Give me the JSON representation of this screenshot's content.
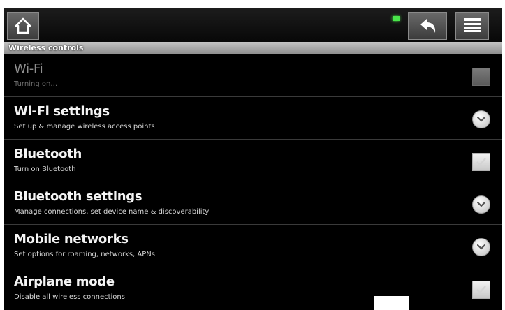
{
  "topbar": {
    "home_icon": "home-icon",
    "back_icon": "back-arrow-icon",
    "menu_icon": "menu-list-icon",
    "status_color": "#49e64a"
  },
  "section": {
    "title": "Wireless controls"
  },
  "rows": [
    {
      "title": "Wi-Fi",
      "summary": "Turning on…",
      "widget": "checkbox",
      "state": "disabled"
    },
    {
      "title": "Wi-Fi settings",
      "summary": "Set up & manage wireless access points",
      "widget": "chevron"
    },
    {
      "title": "Bluetooth",
      "summary": "Turn on Bluetooth",
      "widget": "checkbox",
      "state": "unchecked"
    },
    {
      "title": "Bluetooth settings",
      "summary": "Manage connections, set device name & discoverability",
      "widget": "chevron"
    },
    {
      "title": "Mobile networks",
      "summary": "Set options for roaming, networks, APNs",
      "widget": "chevron"
    },
    {
      "title": "Airplane mode",
      "summary": "Disable all wireless connections",
      "widget": "checkbox",
      "state": "unchecked"
    }
  ],
  "colors": {
    "background": "#000000",
    "header_gradient_top": "#c4c4c4",
    "header_gradient_bottom": "#8c8c8c"
  }
}
